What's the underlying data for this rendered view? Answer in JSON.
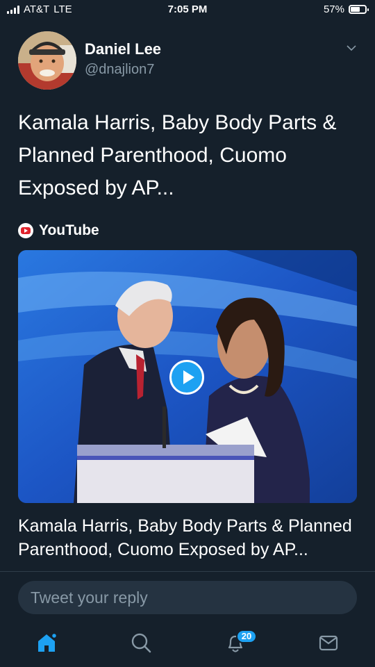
{
  "status_bar": {
    "carrier": "AT&T",
    "network": "LTE",
    "time": "7:05 PM",
    "battery": "57%",
    "battery_level": 0.57
  },
  "tweet": {
    "author_name": "Daniel Lee",
    "author_handle": "@dnajlion7",
    "text": "Kamala Harris, Baby Body Parts & Planned Parenthood, Cuomo Exposed by AP...",
    "menu_icon": "chevron-down-icon"
  },
  "card": {
    "source": "YouTube",
    "source_icon": "youtube-icon",
    "title": "Kamala Harris, Baby Body Parts & Planned Parenthood, Cuomo Exposed by AP...",
    "play_icon": "play-icon"
  },
  "reply": {
    "placeholder": "Tweet your reply"
  },
  "tab_bar": {
    "tabs": [
      {
        "name": "home",
        "icon": "home-icon",
        "active": true
      },
      {
        "name": "search",
        "icon": "search-icon"
      },
      {
        "name": "notifications",
        "icon": "bell-icon",
        "badge": "20"
      },
      {
        "name": "messages",
        "icon": "mail-icon"
      }
    ]
  },
  "colors": {
    "background": "#15202b",
    "accent": "#1da1f2",
    "secondary_text": "#8899a6"
  }
}
